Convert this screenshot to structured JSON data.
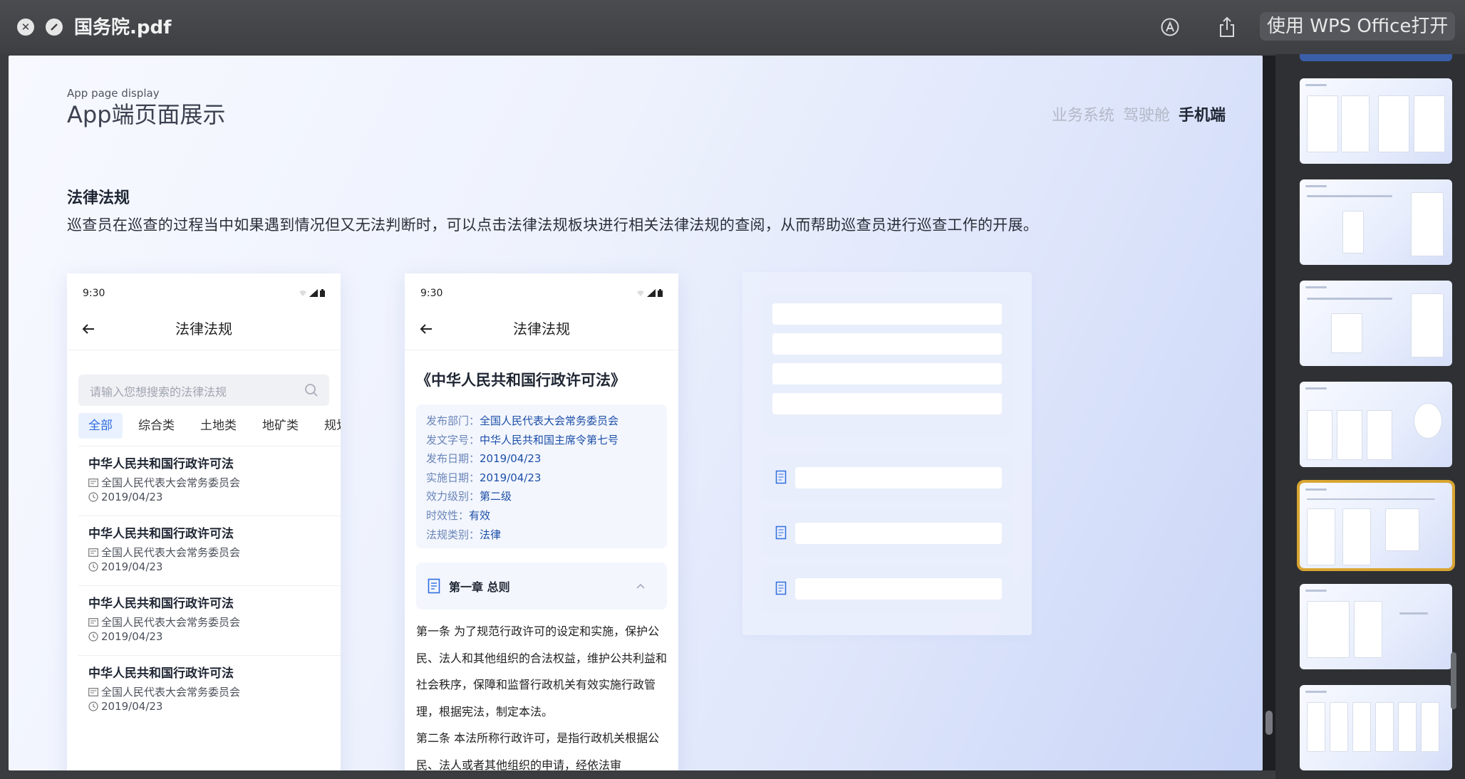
{
  "window": {
    "title": "国务院.pdf",
    "open_with_label": "使用 WPS Office打开",
    "close_icon": "close-icon",
    "minimize_icon": "minimize-icon",
    "markup_icon": "markup-icon",
    "share_icon": "share-icon"
  },
  "page": {
    "header_small": "App page display",
    "header_big": "App端页面展示",
    "nav_tabs": [
      "业务系统",
      "驾驶舱",
      "手机端"
    ],
    "active_nav": "手机端",
    "section_title": "法律法规",
    "section_desc": "巡查员在巡查的过程当中如果遇到情况但又无法判断时，可以点击法律法规板块进行相关法律法规的查阅，从而帮助巡查员进行巡查工作的开展。"
  },
  "phone_list": {
    "time": "9:30",
    "title": "法律法规",
    "search_placeholder": "请输入您想搜索的法律法规",
    "categories": [
      "全部",
      "综合类",
      "土地类",
      "地矿类",
      "规划类"
    ],
    "items": [
      {
        "title": "中华人民共和国行政许可法",
        "dept": "全国人民代表大会常务委员会",
        "date": "2019/04/23"
      },
      {
        "title": "中华人民共和国行政许可法",
        "dept": "全国人民代表大会常务委员会",
        "date": "2019/04/23"
      },
      {
        "title": "中华人民共和国行政许可法",
        "dept": "全国人民代表大会常务委员会",
        "date": "2019/04/23"
      },
      {
        "title": "中华人民共和国行政许可法",
        "dept": "全国人民代表大会常务委员会",
        "date": "2019/04/23"
      }
    ]
  },
  "phone_detail": {
    "time": "9:30",
    "title": "法律法规",
    "law_title": "《中华人民共和国行政许可法》",
    "meta": [
      {
        "k": "发布部门：",
        "v": "全国人民代表大会常务委员会"
      },
      {
        "k": "发文字号：",
        "v": "中华人民共和国主席令第七号"
      },
      {
        "k": "发布日期：",
        "v": "2019/04/23"
      },
      {
        "k": "实施日期：",
        "v": "2019/04/23"
      },
      {
        "k": "效力级别：",
        "v": "第二级"
      },
      {
        "k": "时效性：",
        "v": "有效"
      },
      {
        "k": "法规类别：",
        "v": "法律"
      }
    ],
    "chapter": "第一章  总则",
    "article1": "第一条  为了规范行政许可的设定和实施，保护公民、法人和其他组织的合法权益，维护公共利益和社会秩序，保障和监督行政机关有效实施行政管理，根据宪法，制定本法。",
    "article2": "第二条  本法所称行政许可，是指行政机关根据公民、法人或者其他组织的申请，经依法审"
  },
  "sidebar": {
    "thumbnail_count": 7,
    "selected_index": 4
  }
}
